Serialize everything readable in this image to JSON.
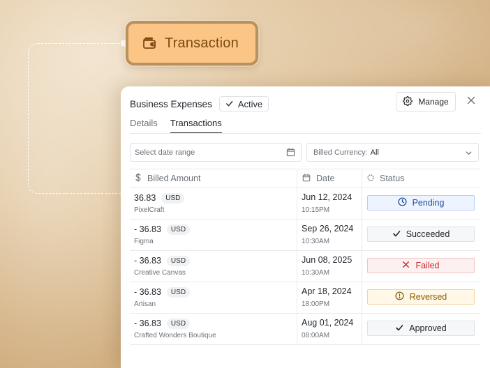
{
  "node": {
    "label": "Transaction"
  },
  "card": {
    "title": "Business Expenses",
    "status_badge": "Active",
    "manage_label": "Manage"
  },
  "tabs": [
    {
      "label": "Details",
      "active": false
    },
    {
      "label": "Transactions",
      "active": true
    }
  ],
  "filters": {
    "date_placeholder": "Select date range",
    "currency_label": "Billed Currency:",
    "currency_value": "All"
  },
  "columns": {
    "amount": "Billed Amount",
    "date": "Date",
    "status": "Status"
  },
  "rows": [
    {
      "amount": "36.83",
      "currency": "USD",
      "merchant": "PixelCraft",
      "date": "Jun 12, 2024",
      "time": "10:15PM",
      "status": "Pending"
    },
    {
      "amount": "- 36.83",
      "currency": "USD",
      "merchant": "Figma",
      "date": "Sep 26, 2024",
      "time": "10:30AM",
      "status": "Succeeded"
    },
    {
      "amount": "- 36.83",
      "currency": "USD",
      "merchant": "Creative Canvas",
      "date": "Jun 08, 2025",
      "time": "10:30AM",
      "status": "Failed"
    },
    {
      "amount": "- 36.83",
      "currency": "USD",
      "merchant": "Artisan",
      "date": "Apr 18, 2024",
      "time": "18:00PM",
      "status": "Reversed"
    },
    {
      "amount": "- 36.83",
      "currency": "USD",
      "merchant": "Crafted Wonders Boutique",
      "date": "Aug 01, 2024",
      "time": "08:00AM",
      "status": "Approved"
    }
  ],
  "status_styles": {
    "Pending": {
      "bg": "#eef4ff",
      "border": "#b9cff5",
      "text": "#1f4d99",
      "icon": "clock-icon"
    },
    "Succeeded": {
      "bg": "#f6f7f9",
      "border": "#dfe2e6",
      "text": "#22262b",
      "icon": "check-icon"
    },
    "Failed": {
      "bg": "#fdf0f0",
      "border": "#f3c4c4",
      "text": "#c62a2a",
      "icon": "x-icon"
    },
    "Reversed": {
      "bg": "#fff8e6",
      "border": "#f1d89a",
      "text": "#8a5a05",
      "icon": "alert-circle-icon"
    },
    "Approved": {
      "bg": "#f6f7f9",
      "border": "#dfe2e6",
      "text": "#22262b",
      "icon": "check-icon"
    }
  },
  "colors": {
    "node_fill": "#fbc585",
    "node_border": "#b8915d",
    "node_text": "#7a4a12"
  }
}
